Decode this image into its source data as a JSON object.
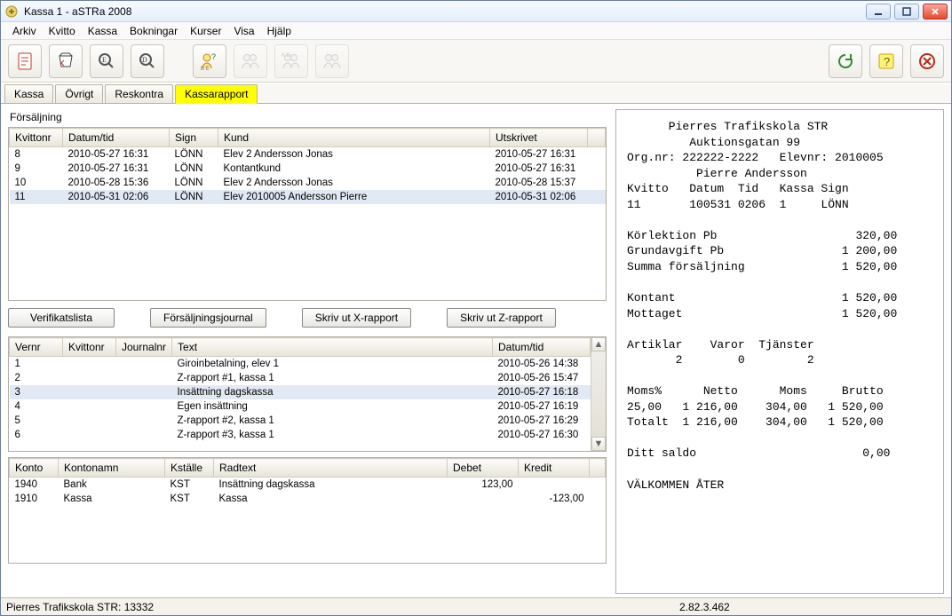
{
  "window": {
    "title": "Kassa 1 - aSTRa 2008"
  },
  "menu": {
    "items": [
      "Arkiv",
      "Kvitto",
      "Kassa",
      "Bokningar",
      "Kurser",
      "Visa",
      "Hjälp"
    ]
  },
  "tabs": {
    "items": [
      "Kassa",
      "Övrigt",
      "Reskontra",
      "Kassarapport"
    ],
    "active_index": 3
  },
  "section_label": "Försäljning",
  "sales_grid": {
    "headers": [
      "Kvittonr",
      "Datum/tid",
      "Sign",
      "Kund",
      "Utskrivet"
    ],
    "rows": [
      {
        "nr": "8",
        "dt": "2010-05-27 16:31",
        "sign": "LÖNN",
        "kund": "Elev 2 Andersson Jonas",
        "ut": "2010-05-27 16:31"
      },
      {
        "nr": "9",
        "dt": "2010-05-27 16:31",
        "sign": "LÖNN",
        "kund": "Kontantkund",
        "ut": "2010-05-27 16:31"
      },
      {
        "nr": "10",
        "dt": "2010-05-28 15:36",
        "sign": "LÖNN",
        "kund": "Elev 2 Andersson Jonas",
        "ut": "2010-05-28 15:37"
      },
      {
        "nr": "11",
        "dt": "2010-05-31 02:06",
        "sign": "LÖNN",
        "kund": "Elev 2010005 Andersson Pierre",
        "ut": "2010-05-31 02:06"
      }
    ],
    "selected_index": 3
  },
  "buttons": {
    "verifikatslista": "Verifikatslista",
    "forsaljningsjournal": "Försäljningsjournal",
    "xreport": "Skriv ut X-rapport",
    "zreport": "Skriv ut Z-rapport"
  },
  "journal_grid": {
    "headers": [
      "Vernr",
      "Kvittonr",
      "Journalnr",
      "Text",
      "Datum/tid"
    ],
    "rows": [
      {
        "v": "1",
        "k": "",
        "j": "",
        "t": "Giroinbetalning, elev 1",
        "dt": "2010-05-26 14:38"
      },
      {
        "v": "2",
        "k": "",
        "j": "",
        "t": "Z-rapport #1, kassa 1",
        "dt": "2010-05-26 15:47"
      },
      {
        "v": "3",
        "k": "",
        "j": "",
        "t": "Insättning dagskassa",
        "dt": "2010-05-27 16:18"
      },
      {
        "v": "4",
        "k": "",
        "j": "",
        "t": "Egen insättning",
        "dt": "2010-05-27 16:19"
      },
      {
        "v": "5",
        "k": "",
        "j": "",
        "t": "Z-rapport #2, kassa 1",
        "dt": "2010-05-27 16:29"
      },
      {
        "v": "6",
        "k": "",
        "j": "",
        "t": "Z-rapport #3, kassa 1",
        "dt": "2010-05-27 16:30"
      }
    ],
    "selected_index": 2
  },
  "ledger_grid": {
    "headers": [
      "Konto",
      "Kontonamn",
      "Kställe",
      "Radtext",
      "Debet",
      "Kredit"
    ],
    "rows": [
      {
        "konto": "1940",
        "namn": "Bank",
        "kst": "KST",
        "rad": "Insättning dagskassa",
        "debet": "123,00",
        "kredit": ""
      },
      {
        "konto": "1910",
        "namn": "Kassa",
        "kst": "KST",
        "rad": "Kassa",
        "debet": "",
        "kredit": "-123,00"
      }
    ]
  },
  "receipt": {
    "lines": "      Pierres Trafikskola STR\n         Auktionsgatan 99\nOrg.nr: 222222-2222   Elevnr: 2010005\n          Pierre Andersson\nKvitto   Datum  Tid   Kassa Sign\n11       100531 0206  1     LÖNN\n\nKörlektion Pb                    320,00\nGrundavgift Pb                 1 200,00\nSumma försäljning              1 520,00\n\nKontant                        1 520,00\nMottaget                       1 520,00\n\nArtiklar    Varor  Tjänster\n       2        0         2\n\nMoms%      Netto      Moms     Brutto\n25,00   1 216,00    304,00   1 520,00\nTotalt  1 216,00    304,00   1 520,00\n\nDitt saldo                        0,00\n\nVÄLKOMMEN ÅTER"
  },
  "statusbar": {
    "left": "Pierres Trafikskola STR: 13332",
    "right": "2.82.3.462"
  }
}
